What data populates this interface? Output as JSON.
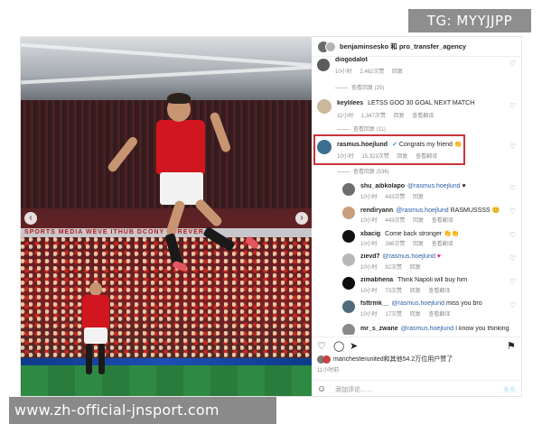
{
  "badge": "TG: MYYJJPP",
  "watermark": "www.zh-official-jnsport.com",
  "photo": {
    "ad_band": "SPORTS  MEDIA  WEVE  ITHUB  DCONY  FOREVER"
  },
  "post": {
    "header_title": "benjaminsesko 和 pro_transfer_agency",
    "comments": [
      {
        "user": "diogodalot",
        "text": "",
        "time": "10小时",
        "likes": "2,462次赞",
        "reply": "回复",
        "translate": "",
        "view_replies": "查看回复 (25)"
      },
      {
        "user": "keylilees",
        "text": "LETSS GOO 30 GOAL NEXT MATCH",
        "time": "11小时",
        "likes": "1,347次赞",
        "reply": "回复",
        "translate": "查看翻译",
        "view_replies": "查看回复 (11)"
      },
      {
        "user": "rasmus.hoejlund",
        "text": "Congrats my friend",
        "emoji": "👏",
        "time": "10小时",
        "likes": "15,323次赞",
        "reply": "回复",
        "translate": "查看翻译",
        "view_replies": "查看回复 (536)"
      }
    ],
    "replies": [
      {
        "user": "shu_aibkolapo",
        "mention": "@rasmus.hoejlund",
        "text": "",
        "emoji": "♥",
        "time": "10小时",
        "likes": "443次赞",
        "reply": "回复",
        "translate": ""
      },
      {
        "user": "rendiryann",
        "mention": "@rasmus.hoejlund",
        "text": "RASMUSSSS",
        "emoji": "😊",
        "time": "10小时",
        "likes": "443次赞",
        "reply": "回复",
        "translate": "查看翻译"
      },
      {
        "user": "xbacig",
        "mention": "",
        "text": "Come back stronger",
        "emoji": "👏👏",
        "time": "10小时",
        "likes": "386次赞",
        "reply": "回复",
        "translate": "查看翻译"
      },
      {
        "user": "zievd7",
        "mention": "@rasmus.hoejlund",
        "text": "",
        "emoji": "♥",
        "time": "10小时",
        "likes": "82次赞",
        "reply": "回复",
        "translate": ""
      },
      {
        "user": "zimabhena",
        "mention": "",
        "text": "Think Napoli will buy him",
        "emoji": "",
        "time": "10小时",
        "likes": "73次赞",
        "reply": "回复",
        "translate": "查看翻译"
      },
      {
        "user": "fsttrmk__",
        "mention": "@rasmus.hoejlund",
        "text": "miss you bro",
        "emoji": "",
        "time": "10小时",
        "likes": "17次赞",
        "reply": "回复",
        "translate": "查看翻译"
      },
      {
        "user": "mr_s_zwane",
        "mention": "@rasmus.hoejlund",
        "text": "I know you thinking",
        "emoji": "",
        "time": "",
        "likes": "",
        "reply": "",
        "translate": ""
      }
    ],
    "likes_text": "manchesterunited和其他54.2万位用户赞了",
    "post_time": "11小时前",
    "add_comment_placeholder": "添加评论……",
    "post_button": "发布"
  },
  "colors": {
    "highlight": "#c8343a",
    "mention": "#2a5ea8",
    "badge_bg": "#8e8e8e",
    "watermark_bg": "#8a8a8a",
    "united_red": "#d2161f"
  }
}
